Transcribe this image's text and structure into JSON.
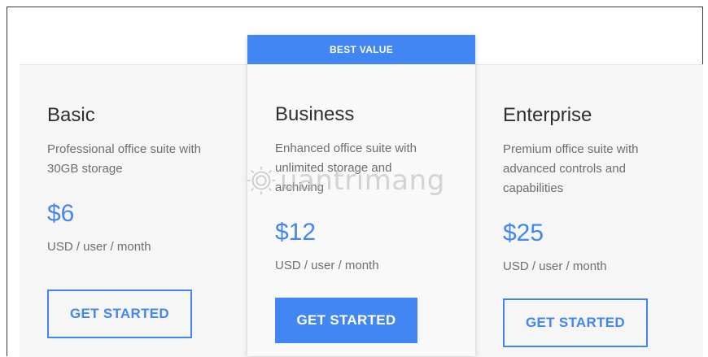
{
  "plans": [
    {
      "name": "Basic",
      "description": "Professional office suite with 30GB storage",
      "price": "$6",
      "unit": "USD / user / month",
      "cta": "GET STARTED"
    },
    {
      "badge": "BEST VALUE",
      "name": "Business",
      "description": "Enhanced office suite with unlimited storage and archiving",
      "price": "$12",
      "unit": "USD / user / month",
      "cta": "GET STARTED"
    },
    {
      "name": "Enterprise",
      "description": "Premium office suite with advanced controls and capabilities",
      "price": "$25",
      "unit": "USD / user / month",
      "cta": "GET STARTED"
    }
  ],
  "watermark": {
    "text": "uantrimang",
    "icon": "sun-logo-icon"
  },
  "colors": {
    "accent": "#4286f4",
    "card_bg": "#f6f6f6",
    "text_dark": "#2f2f2f",
    "text_muted": "#6e6e6e"
  }
}
